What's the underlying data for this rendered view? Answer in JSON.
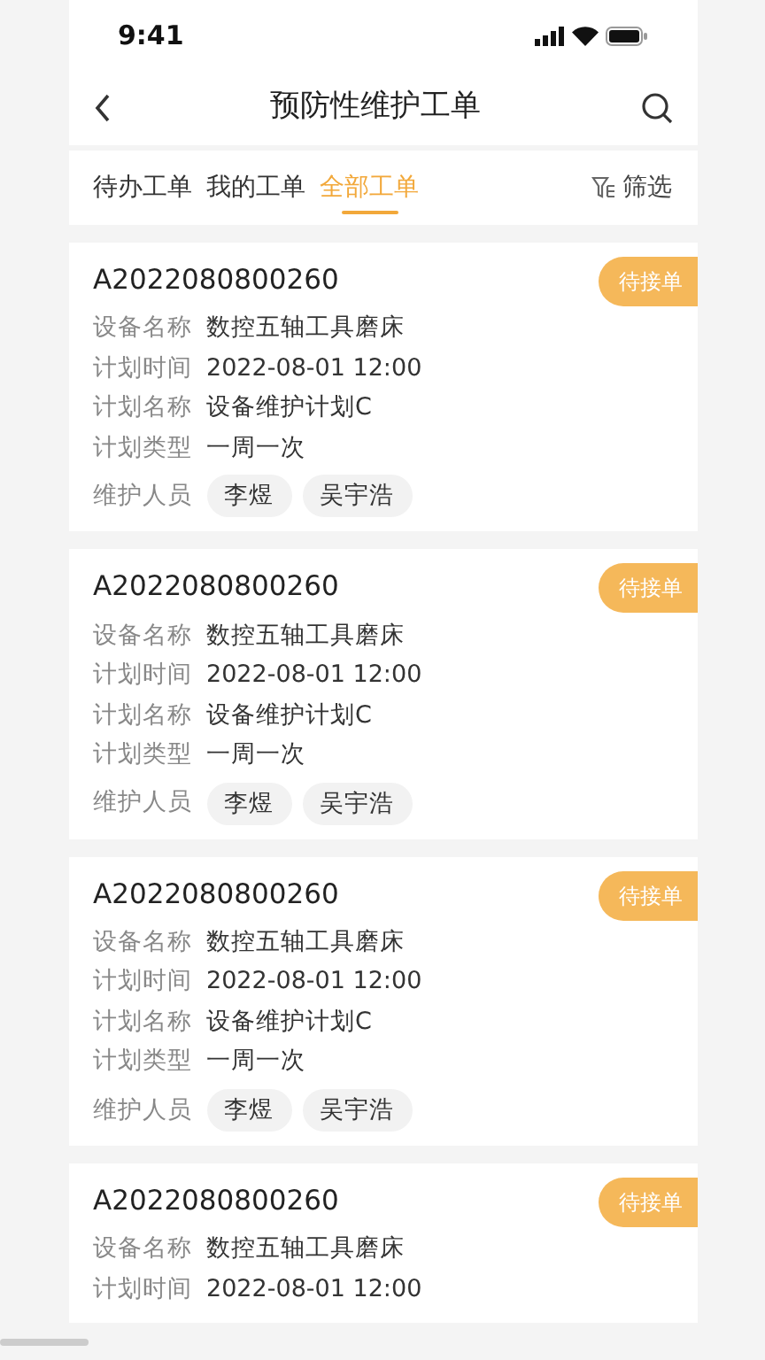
{
  "status_bar": {
    "time": "9:41"
  },
  "header": {
    "title": "预防性维护工单"
  },
  "tabs": [
    {
      "label": "待办工单",
      "selected": false
    },
    {
      "label": "我的工单",
      "selected": false
    },
    {
      "label": "全部工单",
      "selected": true
    }
  ],
  "filter": {
    "label": "筛选"
  },
  "orders": [
    {
      "number": "A2022080800260",
      "status": "待接单",
      "fields": [
        {
          "label": "设备名称",
          "value": "数控五轴工具磨床"
        },
        {
          "label": "计划时间",
          "value": "2022-08-01 12:00"
        },
        {
          "label": "计划名称",
          "value": "设备维护计划C"
        },
        {
          "label": "计划类型",
          "value": "一周一次"
        }
      ],
      "staff_label": "维护人员",
      "staff": [
        "李煜",
        "吴宇浩"
      ]
    },
    {
      "number": "A2022080800260",
      "status": "待接单",
      "fields": [
        {
          "label": "设备名称",
          "value": "数控五轴工具磨床"
        },
        {
          "label": "计划时间",
          "value": "2022-08-01 12:00"
        },
        {
          "label": "计划名称",
          "value": "设备维护计划C"
        },
        {
          "label": "计划类型",
          "value": "一周一次"
        }
      ],
      "staff_label": "维护人员",
      "staff": [
        "李煜",
        "吴宇浩"
      ]
    },
    {
      "number": "A2022080800260",
      "status": "待接单",
      "fields": [
        {
          "label": "设备名称",
          "value": "数控五轴工具磨床"
        },
        {
          "label": "计划时间",
          "value": "2022-08-01 12:00"
        },
        {
          "label": "计划名称",
          "value": "设备维护计划C"
        },
        {
          "label": "计划类型",
          "value": "一周一次"
        }
      ],
      "staff_label": "维护人员",
      "staff": [
        "李煜",
        "吴宇浩"
      ]
    },
    {
      "number": "A2022080800260",
      "status": "待接单",
      "fields": [
        {
          "label": "设备名称",
          "value": "数控五轴工具磨床"
        },
        {
          "label": "计划时间",
          "value": "2022-08-01 12:00"
        }
      ]
    }
  ]
}
